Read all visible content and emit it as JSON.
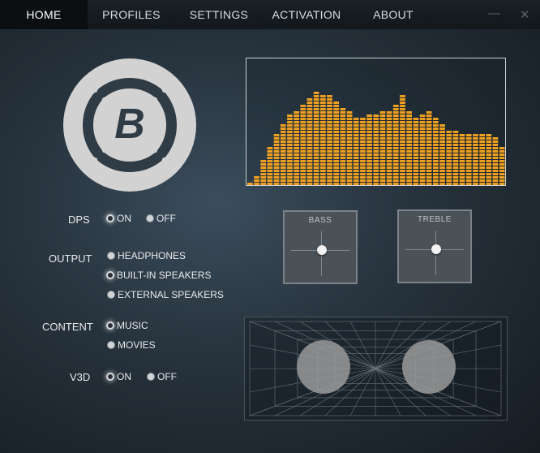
{
  "nav": {
    "tabs": [
      {
        "label": "HOME",
        "active": true
      },
      {
        "label": "PROFILES",
        "active": false
      },
      {
        "label": "SETTINGS",
        "active": false
      },
      {
        "label": "ACTIVATION",
        "active": false
      },
      {
        "label": "ABOUT",
        "active": false
      }
    ],
    "minimize_label": "—",
    "close_label": "✕"
  },
  "logo": {
    "letter": "B"
  },
  "equalizer": {
    "color": "#f0a020",
    "levels": [
      0.02,
      0.08,
      0.2,
      0.32,
      0.41,
      0.5,
      0.57,
      0.6,
      0.64,
      0.7,
      0.75,
      0.72,
      0.72,
      0.67,
      0.63,
      0.6,
      0.53,
      0.53,
      0.57,
      0.57,
      0.6,
      0.6,
      0.65,
      0.72,
      0.6,
      0.55,
      0.57,
      0.6,
      0.53,
      0.48,
      0.44,
      0.44,
      0.41,
      0.41,
      0.41,
      0.41,
      0.41,
      0.39,
      0.32
    ]
  },
  "controls": {
    "dps": {
      "label": "DPS",
      "options": [
        "ON",
        "OFF"
      ],
      "selected": "ON"
    },
    "output": {
      "label": "OUTPUT",
      "options": [
        "HEADPHONES",
        "BUILT-IN SPEAKERS",
        "EXTERNAL SPEAKERS"
      ],
      "selected": "BUILT-IN SPEAKERS"
    },
    "content": {
      "label": "CONTENT",
      "options": [
        "MUSIC",
        "MOVIES"
      ],
      "selected": "MUSIC"
    },
    "v3d": {
      "label": "V3D",
      "options": [
        "ON",
        "OFF"
      ],
      "selected": "ON"
    }
  },
  "tone": {
    "bass": {
      "label": "BASS"
    },
    "treble": {
      "label": "TREBLE"
    }
  }
}
